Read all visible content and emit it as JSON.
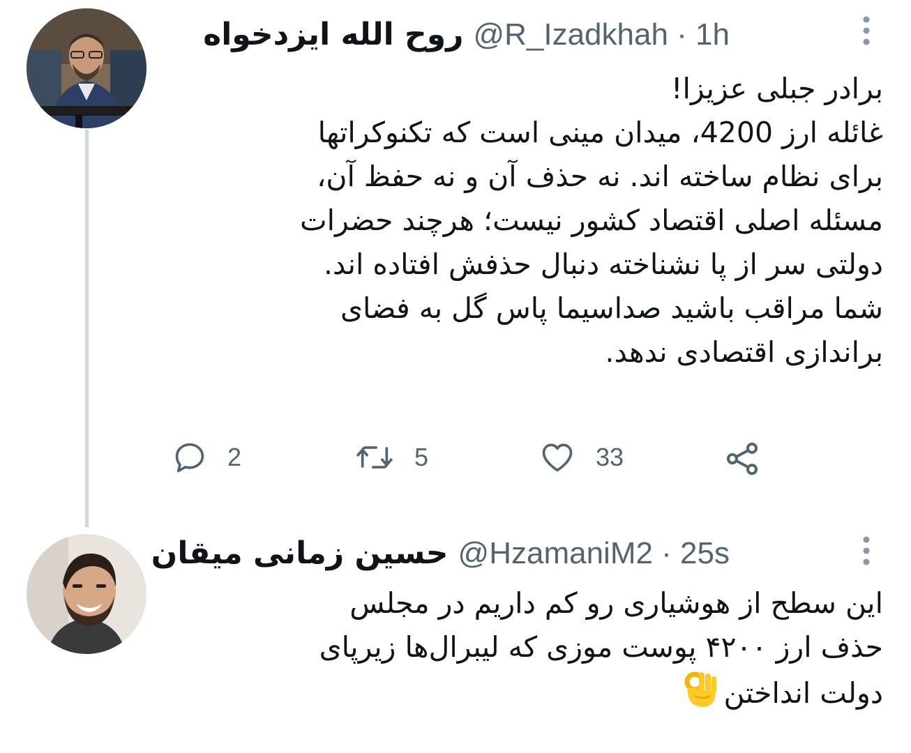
{
  "tweets": [
    {
      "display_name": "روح الله ایزدخواه",
      "handle": "@R_Izadkhah",
      "time": "1h",
      "lines": [
        "برادر جبلی عزیزا!",
        "غائله ارز 4200، میدان مینی است که تکنوکراتها",
        "برای نظام ساخته اند. نه حذف آن و نه حفظ آن،",
        "مسئله اصلی اقتصاد کشور نیست؛ هرچند حضرات",
        "دولتی سر از پا نشناخته دنبال حذفش افتاده اند.",
        "شما مراقب باشید صداسیما پاس گل به فضای",
        "براندازی اقتصادی ندهد."
      ],
      "counts": {
        "reply": "2",
        "retweet": "5",
        "like": "33"
      }
    },
    {
      "display_name": "حسین زمانی میقان",
      "handle": "@HzamaniM2",
      "time": "25s",
      "lines": [
        "این سطح از هوشیاری رو کم داریم در مجلس",
        "حذف ارز ۴۲۰۰ پوست موزی که لیبرال‌ها زیرپای",
        "دولت انداختن"
      ]
    }
  ],
  "separator": " · ",
  "icons": {
    "more": "more-vertical-icon",
    "reply": "reply-icon",
    "retweet": "retweet-icon",
    "like": "heart-icon",
    "share": "share-icon",
    "emoji": "ok-hand-emoji"
  },
  "colors": {
    "text": "#0f1419",
    "secondary": "#536471",
    "thread_line": "#cfd9de"
  }
}
